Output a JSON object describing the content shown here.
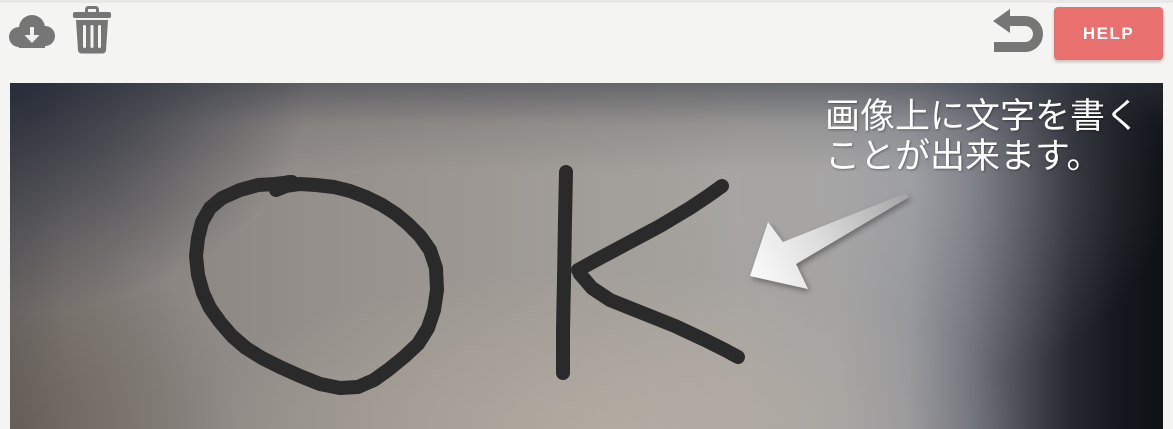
{
  "colors": {
    "page_bg": "#f4f4f2",
    "icon": "#767676",
    "help_bg": "#e8716f",
    "help_text": "#ffffff",
    "ink": "#2a2a2a",
    "annotation_text": "#ffffff"
  },
  "toolbar": {
    "download_icon": "cloud-download-icon",
    "delete_icon": "trash-icon",
    "undo_icon": "undo-icon",
    "help_label": "HELP"
  },
  "canvas": {
    "annotation_lines": [
      "画像上に文字を書く",
      "ことが出来ます。"
    ],
    "pointer_icon": "arrow-icon",
    "sketch_text": "OK"
  }
}
